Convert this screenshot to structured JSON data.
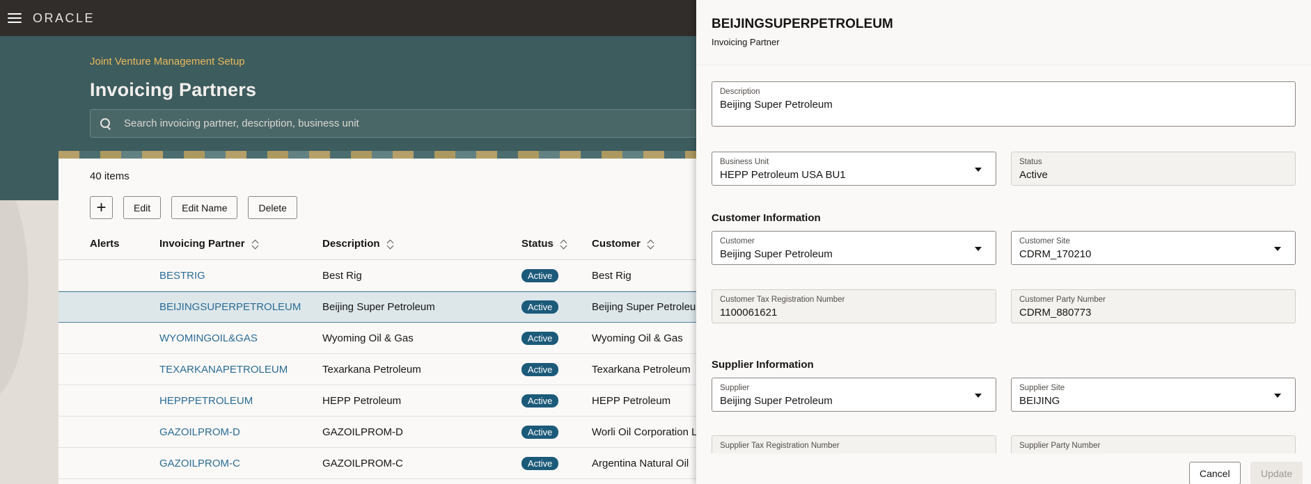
{
  "topbar": {
    "logo": "ORACLE"
  },
  "header": {
    "breadcrumb": "Joint Venture Management Setup",
    "title": "Invoicing Partners",
    "search_placeholder": "Search invoicing partner, description, business unit"
  },
  "list": {
    "count": "40 items",
    "toolbar": {
      "add": "+",
      "edit": "Edit",
      "edit_name": "Edit Name",
      "delete": "Delete"
    },
    "columns": {
      "alerts": "Alerts",
      "partner": "Invoicing Partner",
      "description": "Description",
      "status": "Status",
      "customer": "Customer"
    },
    "rows": [
      {
        "partner": "BESTRIG",
        "description": "Best Rig",
        "status": "Active",
        "customer": "Best Rig"
      },
      {
        "partner": "BEIJINGSUPERPETROLEUM",
        "description": "Beijing Super Petroleum",
        "status": "Active",
        "customer": "Beijing Super Petroleum"
      },
      {
        "partner": "WYOMINGOIL&GAS",
        "description": "Wyoming Oil & Gas",
        "status": "Active",
        "customer": "Wyoming Oil & Gas"
      },
      {
        "partner": "TEXARKANAPETROLEUM",
        "description": "Texarkana Petroleum",
        "status": "Active",
        "customer": "Texarkana Petroleum"
      },
      {
        "partner": "HEPPPETROLEUM",
        "description": "HEPP Petroleum",
        "status": "Active",
        "customer": "HEPP Petroleum"
      },
      {
        "partner": "GAZOILPROM-D",
        "description": "GAZOILPROM-D",
        "status": "Active",
        "customer": "Worli Oil Corporation Ltd"
      },
      {
        "partner": "GAZOILPROM-C",
        "description": "GAZOILPROM-C",
        "status": "Active",
        "customer": "Argentina Natural Oil"
      }
    ]
  },
  "drawer": {
    "title": "BEIJINGSUPERPETROLEUM",
    "subtitle": "Invoicing Partner",
    "description": {
      "label": "Description",
      "value": "Beijing Super Petroleum"
    },
    "business_unit": {
      "label": "Business Unit",
      "value": "HEPP Petroleum USA BU1"
    },
    "status": {
      "label": "Status",
      "value": "Active"
    },
    "customer_section": "Customer Information",
    "customer": {
      "label": "Customer",
      "value": "Beijing Super Petroleum"
    },
    "customer_site": {
      "label": "Customer Site",
      "value": "CDRM_170210"
    },
    "customer_tax": {
      "label": "Customer Tax Registration Number",
      "value": "1100061621"
    },
    "customer_party": {
      "label": "Customer Party Number",
      "value": "CDRM_880773"
    },
    "supplier_section": "Supplier Information",
    "supplier": {
      "label": "Supplier",
      "value": "Beijing Super Petroleum"
    },
    "supplier_site": {
      "label": "Supplier Site",
      "value": "BEIJING"
    },
    "supplier_tax": {
      "label": "Supplier Tax Registration Number"
    },
    "supplier_party": {
      "label": "Supplier Party Number"
    },
    "cancel": "Cancel",
    "update": "Update"
  }
}
